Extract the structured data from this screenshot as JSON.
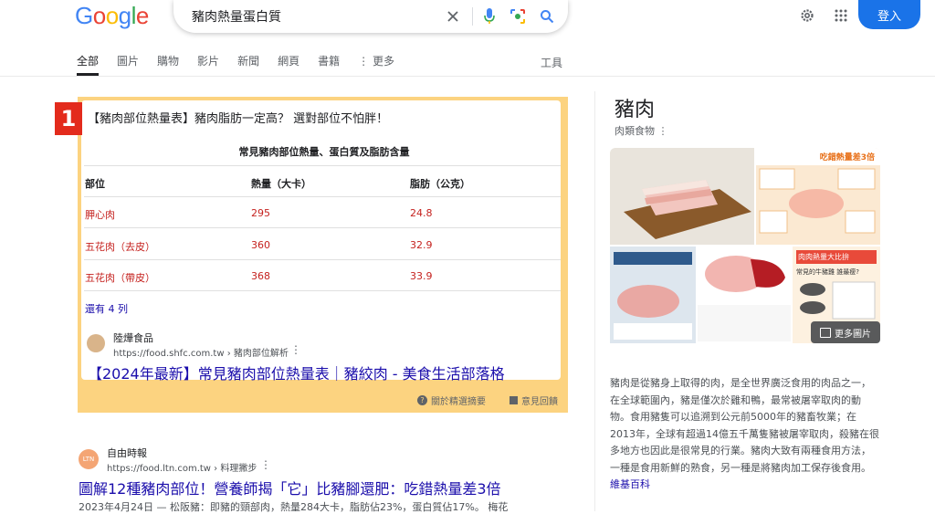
{
  "logo": [
    "G",
    "o",
    "o",
    "g",
    "l",
    "e"
  ],
  "logo_colors": [
    "#4285F4",
    "#EA4335",
    "#FBBC05",
    "#4285F4",
    "#34A853",
    "#EA4335"
  ],
  "search": {
    "query": "豬肉熱量蛋白質"
  },
  "header": {
    "signin_label": "登入"
  },
  "tabs": [
    "全部",
    "圖片",
    "購物",
    "影片",
    "新聞",
    "網頁",
    "書籍",
    "更多"
  ],
  "tools_label": "工具",
  "snippet": {
    "rank": "1",
    "title": "【豬肉部位熱量表】豬肉脂肪一定高？ 選對部位不怕胖！",
    "caption": "常見豬肉部位熱量、蛋白質及脂肪含量",
    "headers": [
      "部位",
      "熱量（大卡）",
      "脂肪（公克）"
    ],
    "rows": [
      [
        "胛心肉",
        "295",
        "24.8"
      ],
      [
        "五花肉（去皮）",
        "360",
        "32.9"
      ],
      [
        "五花肉（帶皮）",
        "368",
        "33.9"
      ]
    ],
    "more_rows": "還有 4 列",
    "site_name": "陸燁食品",
    "site_url": "https://food.shfc.com.tw › 豬肉部位解析",
    "result_title": "【2024年最新】常見豬肉部位熱量表｜豬絞肉 - 美食生活部落格",
    "about_label": "關於精選摘要",
    "feedback_label": "意見回饋"
  },
  "result2": {
    "favicon_text": "LTN",
    "site_name": "自由時報",
    "site_url": "https://food.ltn.com.tw › 料理撇步",
    "title": "圖解12種豬肉部位！營養師揭「它」比豬腳還肥：吃錯熱量差3倍",
    "snippet": "2023年4月24日 — 松阪豬：即豬的頸部肉，熱量284大卡，脂肪佔23%，蛋白質佔17%。 梅花"
  },
  "knowledge_panel": {
    "title": "豬肉",
    "subtitle": "肉類食物",
    "more_images": "更多圖片",
    "img_text_a": "吃錯熱量差3倍",
    "img_text_b": "肉肉熱量大比拚",
    "img_text_c": "常見的牛豬雞 誰最瘦?",
    "description": "豬肉是從豬身上取得的肉，是全世界廣泛食用的肉品之一，在全球範圍內，豬是僅次於雞和鴨，最常被屠宰取肉的動物。食用豬隻可以追溯到公元前5000年的豬畜牧業；在2013年，全球有超過14億五千萬隻豬被屠宰取肉，殺豬在很多地方也因此是很常見的行業。豬肉大致有兩種食用方法，一種是食用新鮮的熟食，另一種是將豬肉加工保存後食用。",
    "source_link": "維基百科"
  }
}
